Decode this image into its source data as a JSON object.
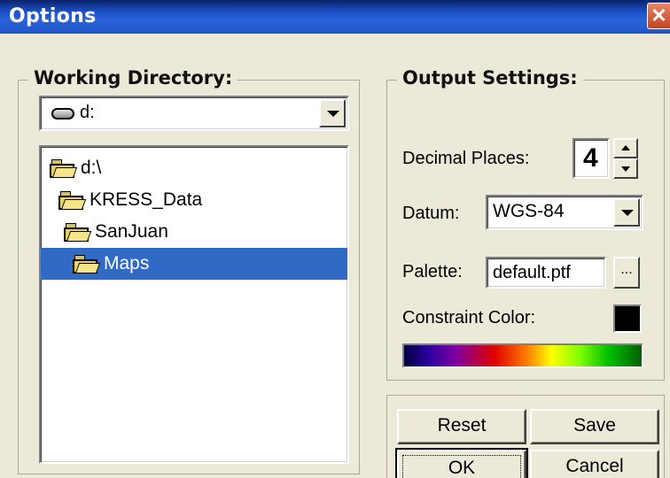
{
  "window": {
    "title": "Options",
    "close_icon": "close-icon"
  },
  "working_directory": {
    "legend": "Working Directory:",
    "drive": {
      "icon": "drive-icon",
      "value": "d:"
    },
    "tree": [
      {
        "label": "d:\\",
        "icon": "open-folder-icon",
        "selected": false
      },
      {
        "label": "KRESS_Data",
        "icon": "open-folder-icon",
        "selected": false
      },
      {
        "label": "SanJuan",
        "icon": "open-folder-icon",
        "selected": false
      },
      {
        "label": "Maps",
        "icon": "open-folder-icon",
        "selected": true
      }
    ]
  },
  "output_settings": {
    "legend": "Output Settings:",
    "decimal_places": {
      "label": "Decimal Places:",
      "value": "4"
    },
    "datum": {
      "label": "Datum:",
      "value": "WGS-84"
    },
    "palette": {
      "label": "Palette:",
      "value": "default.ptf",
      "browse_label": "..."
    },
    "constraint_color": {
      "label": "Constraint Color:",
      "color": "#000000"
    }
  },
  "buttons": {
    "reset": "Reset",
    "save": "Save",
    "ok": "OK",
    "cancel": "Cancel"
  },
  "colors": {
    "title_bar": "#1f55c9",
    "selection": "#316ac5",
    "dialog_bg": "#ece9d8"
  }
}
